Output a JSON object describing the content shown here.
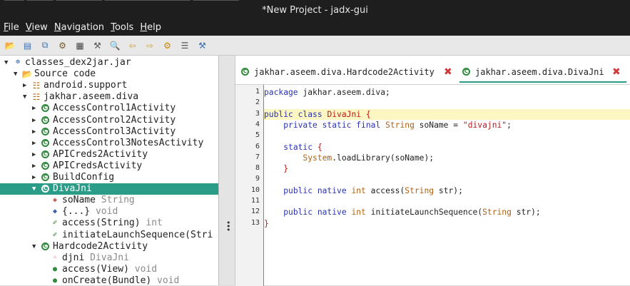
{
  "window": {
    "title": "*New Project - jadx-gui",
    "ghost_text": "▀▀▀   ▀▀▀▀   ▀▀▀▀▀▀▀   ▀▀▀▀▀▀▀▀▀▀▀▀▀   ▀▀▀▀▀▀▀"
  },
  "menu": [
    "File",
    "View",
    "Navigation",
    "Tools",
    "Help"
  ],
  "toolbar": {
    "icons": [
      {
        "name": "open-folder-icon",
        "glyph": "📂",
        "color": "#d89a2a"
      },
      {
        "name": "save-icon",
        "glyph": "▤",
        "color": "#3a6fb0"
      },
      {
        "name": "save-all-icon",
        "glyph": "⧉",
        "color": "#3a6fb0"
      },
      {
        "name": "sync-icon",
        "glyph": "⚙",
        "color": "#7a5a2a"
      },
      {
        "name": "flatten-packages-icon",
        "glyph": "▦",
        "color": "#444"
      },
      {
        "name": "search-text-icon",
        "glyph": "⚒",
        "color": "#555"
      },
      {
        "name": "find-class-icon",
        "glyph": "🔍",
        "color": "#3a6fb0"
      },
      {
        "name": "back-icon",
        "glyph": "⇦",
        "color": "#d8a02a"
      },
      {
        "name": "forward-icon",
        "glyph": "⇨",
        "color": "#d8a02a"
      },
      {
        "name": "decompile-all-icon",
        "glyph": "⚙",
        "color": "#c28a1a"
      },
      {
        "name": "log-icon",
        "glyph": "☰",
        "color": "#555"
      },
      {
        "name": "preferences-icon",
        "glyph": "⚒",
        "color": "#3a6fb0"
      }
    ]
  },
  "tree": [
    {
      "indent": 0,
      "toggle": "▼",
      "icon": "jar-icon",
      "glyph": "☸",
      "label": "classes_dex2jar.jar",
      "suffix": ""
    },
    {
      "indent": 1,
      "toggle": "▼",
      "icon": "source-folder-icon",
      "glyph": "📂",
      "label": "Source code",
      "suffix": ""
    },
    {
      "indent": 2,
      "toggle": "▶",
      "icon": "package-icon",
      "glyph": "☷",
      "label": "android.support",
      "suffix": ""
    },
    {
      "indent": 2,
      "toggle": "▼",
      "icon": "package-icon",
      "glyph": "☷",
      "label": "jakhar.aseem.diva",
      "suffix": ""
    },
    {
      "indent": 3,
      "toggle": "▶",
      "icon": "class-icon",
      "glyph": "C",
      "label": "AccessControl1Activity",
      "suffix": ""
    },
    {
      "indent": 3,
      "toggle": "▶",
      "icon": "class-icon",
      "glyph": "C",
      "label": "AccessControl2Activity",
      "suffix": ""
    },
    {
      "indent": 3,
      "toggle": "▶",
      "icon": "class-icon",
      "glyph": "C",
      "label": "AccessControl3Activity",
      "suffix": ""
    },
    {
      "indent": 3,
      "toggle": "▶",
      "icon": "class-icon",
      "glyph": "C",
      "label": "AccessControl3NotesActivity",
      "suffix": ""
    },
    {
      "indent": 3,
      "toggle": "▶",
      "icon": "class-icon",
      "glyph": "C",
      "label": "APICreds2Activity",
      "suffix": ""
    },
    {
      "indent": 3,
      "toggle": "▶",
      "icon": "class-icon",
      "glyph": "C",
      "label": "APICredsActivity",
      "suffix": ""
    },
    {
      "indent": 3,
      "toggle": "▶",
      "icon": "class-icon",
      "glyph": "C",
      "label": "BuildConfig",
      "suffix": ""
    },
    {
      "indent": 3,
      "toggle": "▼",
      "icon": "class-icon",
      "glyph": "C",
      "label": "DivaJni",
      "suffix": "",
      "selected": true
    },
    {
      "indent": 4,
      "toggle": "",
      "icon": "field-icon",
      "glyph": "◈",
      "label": "soName",
      "suffix": "String"
    },
    {
      "indent": 4,
      "toggle": "",
      "icon": "static-init-icon",
      "glyph": "◆",
      "label": "{...}",
      "suffix": "void"
    },
    {
      "indent": 4,
      "toggle": "",
      "icon": "native-method-icon",
      "glyph": "✐",
      "label": "access(String)",
      "suffix": "int"
    },
    {
      "indent": 4,
      "toggle": "",
      "icon": "native-method-icon",
      "glyph": "✐",
      "label": "initiateLaunchSequence(Stri",
      "suffix": ""
    },
    {
      "indent": 3,
      "toggle": "▼",
      "icon": "class-icon",
      "glyph": "C",
      "label": "Hardcode2Activity",
      "suffix": ""
    },
    {
      "indent": 4,
      "toggle": "",
      "icon": "private-field-icon",
      "glyph": "◦",
      "label": "djni",
      "suffix": "DivaJni"
    },
    {
      "indent": 4,
      "toggle": "",
      "icon": "method-icon",
      "glyph": "●",
      "label": "access(View)",
      "suffix": "void"
    },
    {
      "indent": 4,
      "toggle": "",
      "icon": "method-icon",
      "glyph": "●",
      "label": "onCreate(Bundle)",
      "suffix": "void"
    }
  ],
  "tabs": [
    {
      "label": "jakhar.aseem.diva.Hardcode2Activity",
      "active": false
    },
    {
      "label": "jakhar.aseem.diva.DivaJni",
      "active": true
    }
  ],
  "editor": {
    "highlight_line": 3,
    "lines": [
      [
        [
          "kw",
          "package"
        ],
        [
          "plain",
          " jakhar.aseem.diva;"
        ]
      ],
      [],
      [
        [
          "kw",
          "public class"
        ],
        [
          "plain",
          " "
        ],
        [
          "str",
          "DivaJni {"
        ]
      ],
      [
        [
          "plain",
          "    "
        ],
        [
          "kw",
          "private static final"
        ],
        [
          "plain",
          " "
        ],
        [
          "typ",
          "String"
        ],
        [
          "plain",
          " soName = "
        ],
        [
          "str",
          "\"divajni\""
        ],
        [
          "plain",
          ";"
        ]
      ],
      [],
      [
        [
          "plain",
          "    "
        ],
        [
          "kw",
          "static"
        ],
        [
          "plain",
          " "
        ],
        [
          "str",
          "{"
        ]
      ],
      [
        [
          "plain",
          "        "
        ],
        [
          "typ",
          "System"
        ],
        [
          "plain",
          ".loadLibrary(soName);"
        ]
      ],
      [
        [
          "plain",
          "    "
        ],
        [
          "str",
          "}"
        ]
      ],
      [],
      [
        [
          "plain",
          "    "
        ],
        [
          "kw",
          "public native"
        ],
        [
          "plain",
          " "
        ],
        [
          "typ",
          "int"
        ],
        [
          "plain",
          " access("
        ],
        [
          "typ",
          "String"
        ],
        [
          "plain",
          " str);"
        ]
      ],
      [],
      [
        [
          "plain",
          "    "
        ],
        [
          "kw",
          "public native"
        ],
        [
          "plain",
          " "
        ],
        [
          "typ",
          "int"
        ],
        [
          "plain",
          " initiateLaunchSequence("
        ],
        [
          "typ",
          "String"
        ],
        [
          "plain",
          " str);"
        ]
      ],
      [
        [
          "str",
          "}"
        ]
      ]
    ]
  }
}
